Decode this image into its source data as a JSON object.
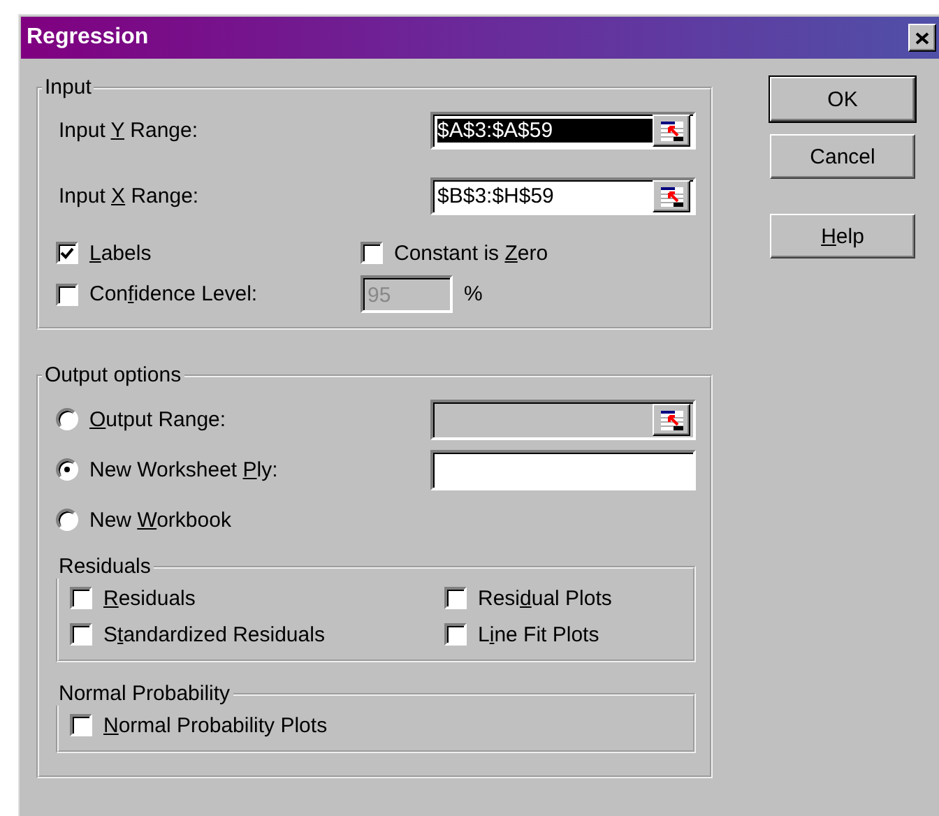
{
  "window": {
    "title": "Regression"
  },
  "input": {
    "title": "Input",
    "ranges": [
      {
        "label": {
          "before": "Input ",
          "key": "Y",
          "after": " Range:"
        },
        "value": "$A$3:$A$59",
        "text_selected": true
      },
      {
        "label": {
          "before": "Input ",
          "key": "X",
          "after": " Range:"
        },
        "value": "$B$3:$H$59",
        "text_selected": false
      }
    ],
    "options": [
      {
        "label": {
          "key": "L",
          "after": "abels"
        },
        "checked": true
      },
      {
        "label": {
          "before": "Constant is ",
          "key": "Z",
          "after": "ero"
        },
        "checked": false
      }
    ],
    "confidence": {
      "label": {
        "before": "Con",
        "key": "f",
        "after": "idence Level:"
      },
      "checked": false,
      "value": "95",
      "disabled": true,
      "unit": "%"
    }
  },
  "output": {
    "title": "Output options",
    "choices": [
      {
        "label": {
          "key": "O",
          "after": "utput Range:"
        },
        "selected": false,
        "field": {
          "disabled": true,
          "ref_button": true
        }
      },
      {
        "label": {
          "before": "New Worksheet ",
          "key": "P",
          "after": "ly:"
        },
        "selected": true,
        "field": {
          "disabled": false,
          "ref_button": false
        }
      },
      {
        "label": {
          "before": "New ",
          "key": "W",
          "after": "orkbook"
        },
        "selected": false
      }
    ],
    "residuals": {
      "title": "Residuals",
      "options": [
        {
          "label": {
            "key": "R",
            "after": "esiduals"
          },
          "checked": false
        },
        {
          "label": {
            "before": "Resi",
            "key": "d",
            "after": "ual Plots"
          },
          "checked": false
        },
        {
          "label": {
            "before": "S",
            "key": "t",
            "after": "andardized Residuals"
          },
          "checked": false
        },
        {
          "label": {
            "before": "L",
            "key": "i",
            "after": "ne Fit Plots"
          },
          "checked": false
        }
      ]
    },
    "normal": {
      "title": "Normal Probability",
      "options": [
        {
          "label": {
            "key": "N",
            "after": "ormal Probability Plots"
          },
          "checked": false
        }
      ]
    }
  },
  "buttons": [
    {
      "label": {
        "before": "OK"
      },
      "default": true
    },
    {
      "label": {
        "before": "Cancel"
      },
      "default": false
    },
    {
      "label": {
        "key": "H",
        "after": "elp"
      },
      "default": false
    }
  ]
}
